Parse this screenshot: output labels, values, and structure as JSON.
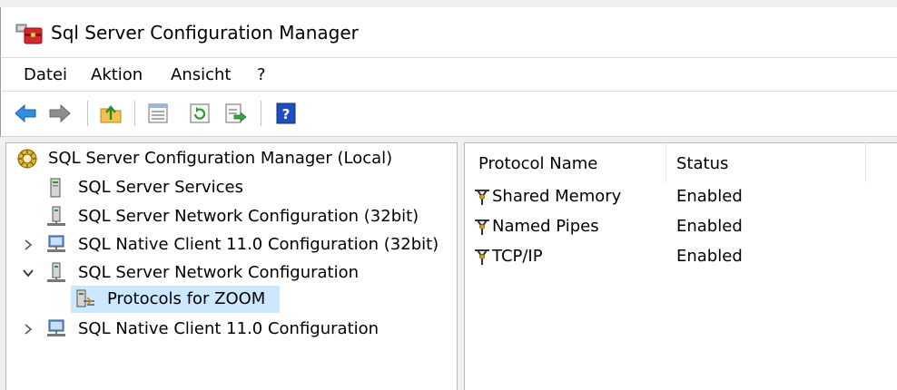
{
  "window": {
    "title": "Sql Server Configuration Manager"
  },
  "menu": {
    "items": [
      "Datei",
      "Aktion",
      "Ansicht",
      "?"
    ]
  },
  "toolbar": {
    "buttons": [
      "back-arrow-icon",
      "forward-arrow-icon",
      "up-folder-icon",
      "properties-icon",
      "refresh-icon",
      "export-list-icon",
      "help-icon"
    ]
  },
  "tree": {
    "root": "SQL Server Configuration Manager (Local)",
    "items": [
      "SQL Server Services",
      "SQL Server Network Configuration (32bit)",
      "SQL Native Client 11.0 Configuration (32bit)",
      "SQL Server Network Configuration",
      "Protocols for ZOOM",
      "SQL Native Client 11.0 Configuration"
    ],
    "selected": "Protocols for ZOOM"
  },
  "list": {
    "columns": [
      "Protocol Name",
      "Status"
    ],
    "rows": [
      {
        "name": "Shared Memory",
        "status": "Enabled"
      },
      {
        "name": "Named Pipes",
        "status": "Enabled"
      },
      {
        "name": "TCP/IP",
        "status": "Enabled"
      }
    ]
  },
  "colors": {
    "selection": "#cce8ff",
    "help_blue": "#1f4fbf",
    "arrow_blue": "#2f8fe0"
  }
}
